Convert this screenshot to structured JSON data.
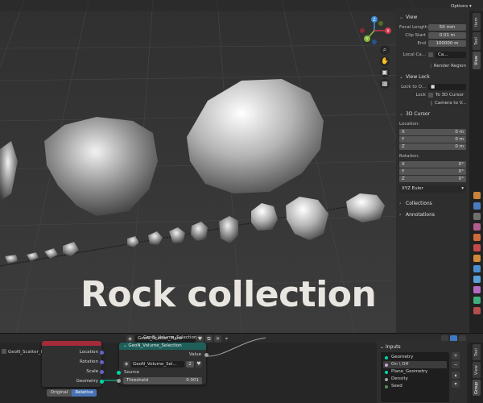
{
  "viewport": {
    "options_label": "Options",
    "caption": "Rock collection",
    "gizmo": {
      "x_label": "X",
      "y_label": "Y",
      "z_label": "Z"
    },
    "nav_icons": [
      "zoom-icon",
      "pan-hand-icon",
      "camera-icon",
      "grid-icon"
    ]
  },
  "sidebar": {
    "view_section": {
      "title": "View",
      "focal_length_label": "Focal Length",
      "focal_length_value": "50 mm",
      "clip_start_label": "Clip Start",
      "clip_start_value": "0.01 m",
      "end_label": "End",
      "end_value": "100000 m",
      "local_camera_label": "Local Ca...",
      "local_camera_value": "Ca...",
      "render_region_label": "Render Region"
    },
    "view_lock_section": {
      "title": "View Lock",
      "lock_to_object_label": "Lock to O...",
      "lock_label": "Lock",
      "to_3d_cursor_label": "To 3D Cursor",
      "camera_to_view_label": "Camera to V..."
    },
    "cursor_section": {
      "title": "3D Cursor",
      "location_label": "Location:",
      "location": [
        {
          "axis": "X",
          "value": "0 m"
        },
        {
          "axis": "Y",
          "value": "0 m"
        },
        {
          "axis": "Z",
          "value": "0 m"
        }
      ],
      "rotation_label": "Rotation:",
      "rotation": [
        {
          "axis": "X",
          "value": "0°"
        },
        {
          "axis": "Y",
          "value": "0°"
        },
        {
          "axis": "Z",
          "value": "0°"
        }
      ],
      "rotation_mode": "XYZ Euler"
    },
    "collapsed_sections": [
      "Collections",
      "Annotations"
    ],
    "tabs": [
      "Item",
      "Tool",
      "View"
    ]
  },
  "node_editor": {
    "tree_name": "GeoN_Scatter_Plane",
    "left_object_label": "GeoN_Scatter_Plane",
    "object_info_node": {
      "outputs": [
        "Location",
        "Rotation",
        "Scale",
        "Geometry"
      ],
      "transform_options": [
        "Original",
        "Relative"
      ],
      "active_option": "Relative"
    },
    "volume_selection_node": {
      "frame_label": "GeoN_Volume_Selection",
      "title": "GeoN_Volume_Selection",
      "output_label": "Value",
      "group_field": "GeoN_Volume_Sel...",
      "group_users": "2",
      "source_label": "Source",
      "threshold_label": "Threshold",
      "threshold_value": "0.001"
    },
    "inputs_panel": {
      "title": "Inputs",
      "items": [
        {
          "label": "Geometry",
          "color": "#00d6a3"
        },
        {
          "label": "On \\ Off",
          "color": "#cca6d6"
        },
        {
          "label": "Plane_Geometry",
          "color": "#00d6a3"
        },
        {
          "label": "Density",
          "color": "#a1a1a1"
        },
        {
          "label": "Seed",
          "color": "#598c5c"
        }
      ],
      "selected_index": 1
    },
    "tabs": [
      "Tool",
      "View",
      "Group"
    ]
  }
}
